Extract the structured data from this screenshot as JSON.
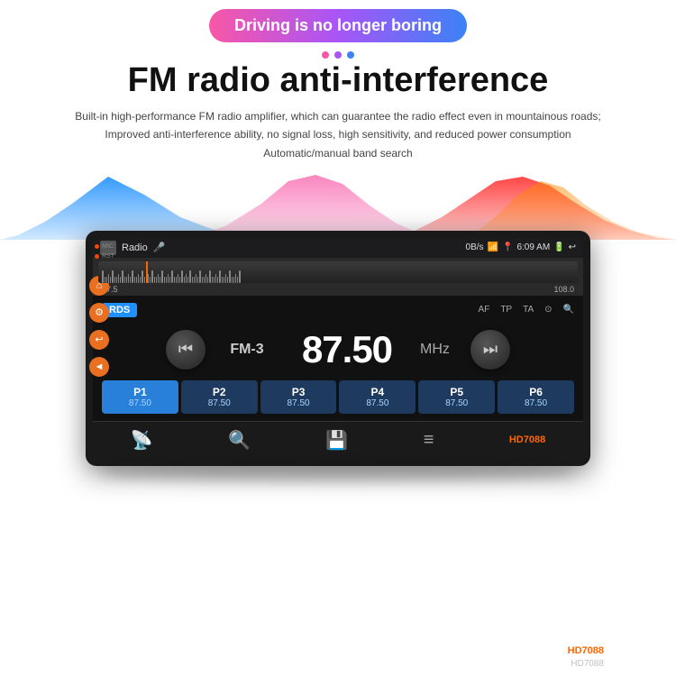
{
  "banner": {
    "text": "Driving is no longer boring"
  },
  "dots": [
    "pink",
    "purple",
    "blue"
  ],
  "title": "FM radio anti-interference",
  "description": {
    "line1": "Built-in high-performance FM radio amplifier, which can guarantee the radio effect even in mountainous roads;",
    "line2": "Improved anti-interference ability, no signal loss, high sensitivity, and reduced power consumption",
    "line3": "Automatic/manual band search"
  },
  "device": {
    "brand": "HD7088",
    "status_bar": {
      "label": "Radio",
      "mic": "🎤",
      "data": "0B/s",
      "signal": "📶",
      "location": "📍",
      "time": "6:09 AM",
      "battery": "🔋",
      "back": "↩"
    },
    "tuner": {
      "freq_start": "87.5",
      "freq_end": "108.0"
    },
    "rds": "RDS",
    "controls": [
      "AF",
      "TP",
      "TA",
      "🔍",
      "🔍"
    ],
    "band": "FM-3",
    "frequency": "87.50",
    "unit": "MHz",
    "presets": [
      {
        "label": "P1",
        "freq": "87.50",
        "active": true
      },
      {
        "label": "P2",
        "freq": "87.50",
        "active": false
      },
      {
        "label": "P3",
        "freq": "87.50",
        "active": false
      },
      {
        "label": "P4",
        "freq": "87.50",
        "active": false
      },
      {
        "label": "P5",
        "freq": "87.50",
        "active": false
      },
      {
        "label": "P6",
        "freq": "87.50",
        "active": false
      }
    ],
    "nav_icons": [
      "wifi",
      "search",
      "save",
      "menu"
    ]
  }
}
